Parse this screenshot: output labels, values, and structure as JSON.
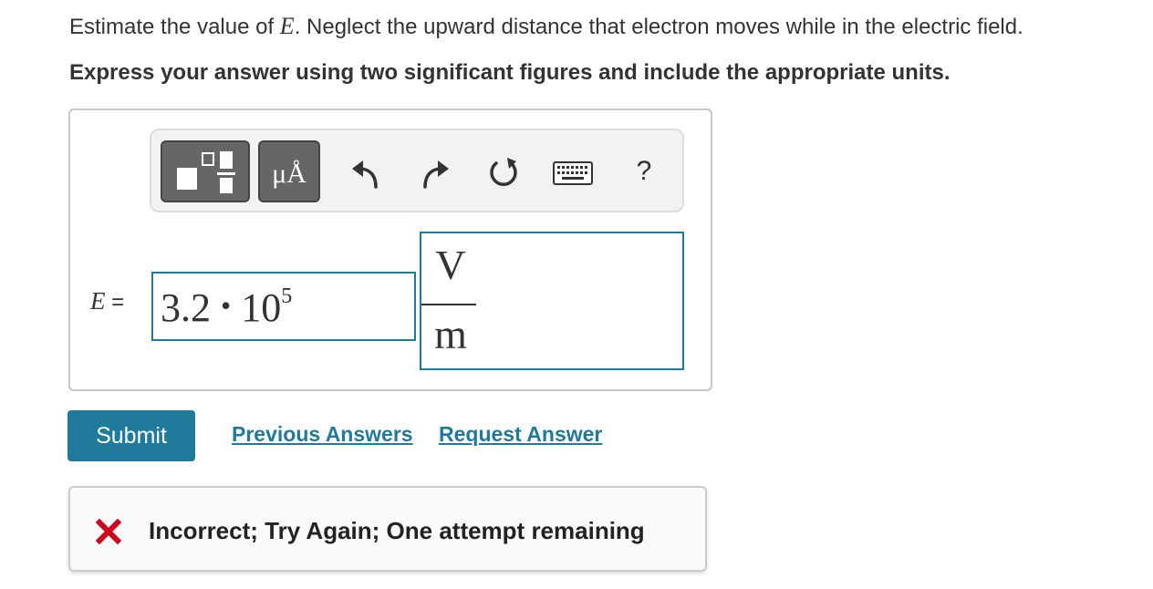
{
  "question": {
    "prefix": "Estimate the value of ",
    "variable": "E",
    "suffix": ". Neglect the upward distance that electron moves while in the electric field.",
    "instruction": "Express your answer using two significant figures and include the appropriate units."
  },
  "toolbar": {
    "units_label": "μÅ",
    "help_label": "?",
    "icons": [
      "templates-icon",
      "units-icon",
      "undo-icon",
      "redo-icon",
      "reset-icon",
      "keyboard-icon",
      "help-icon"
    ]
  },
  "answer": {
    "variable": "E",
    "equals": "=",
    "value_mantissa": "3.2",
    "value_operator": "•",
    "value_base": "10",
    "value_exponent": "5",
    "unit_numerator": "V",
    "unit_denominator": "m"
  },
  "actions": {
    "submit_label": "Submit",
    "previous_answers_label": "Previous Answers",
    "request_answer_label": "Request Answer"
  },
  "feedback": {
    "message": "Incorrect; Try Again; One attempt remaining",
    "status_color": "#d0021b"
  },
  "colors": {
    "accent": "#1f7a9c",
    "toolbar_button": "#666666"
  }
}
